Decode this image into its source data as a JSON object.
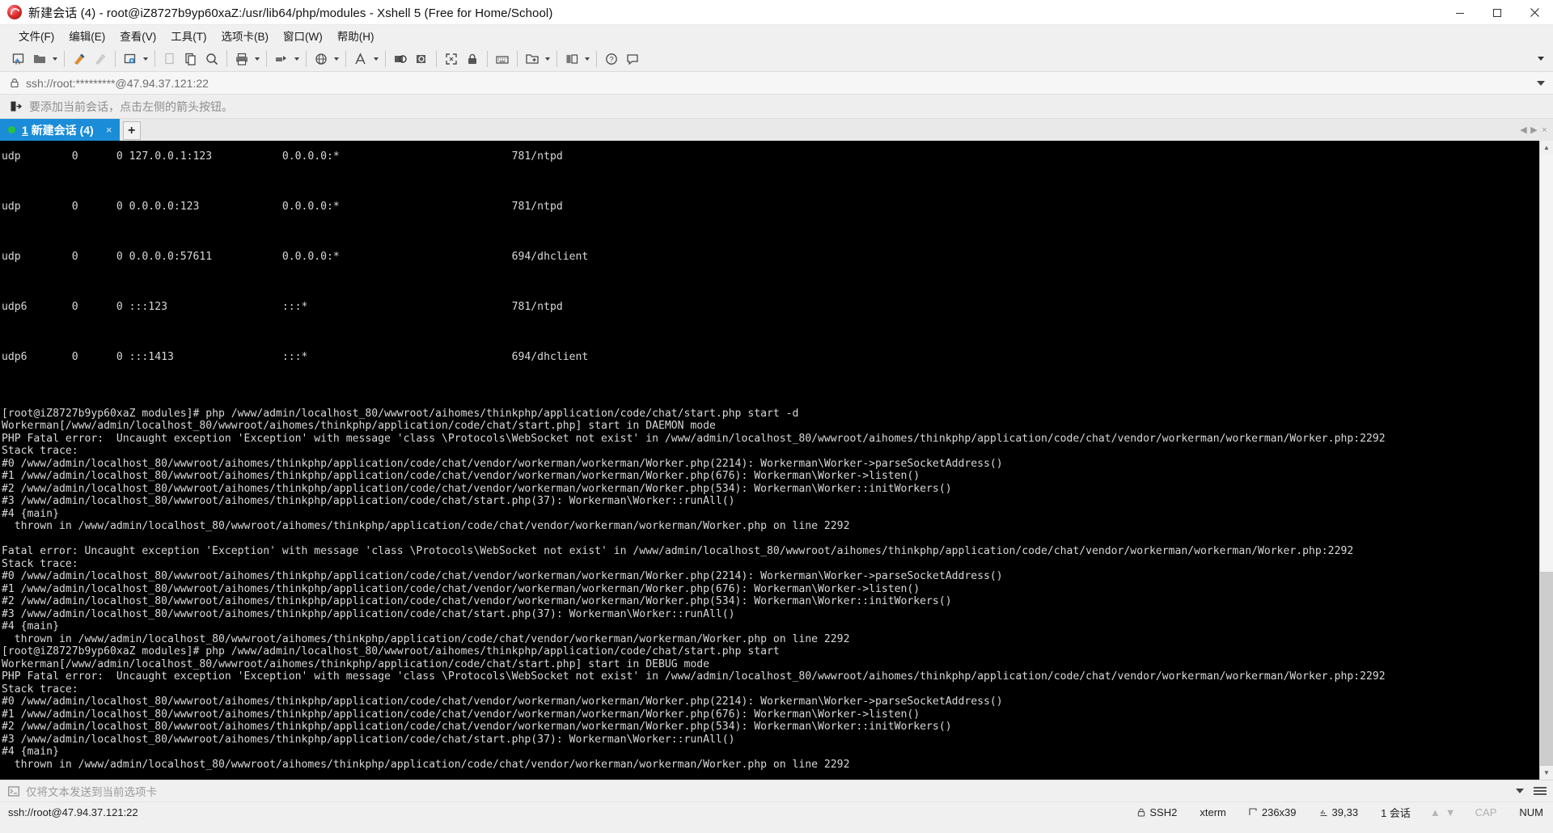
{
  "window": {
    "title": "新建会话 (4) - root@iZ8727b9yp60xaZ:/usr/lib64/php/modules - Xshell 5 (Free for Home/School)",
    "app_icon": "xshell-logo-icon",
    "minimize_label": "最小化",
    "maximize_label": "最大化",
    "close_label": "关闭"
  },
  "menubar": {
    "items": [
      {
        "label": "文件(F)",
        "name": "menu-file"
      },
      {
        "label": "编辑(E)",
        "name": "menu-edit"
      },
      {
        "label": "查看(V)",
        "name": "menu-view"
      },
      {
        "label": "工具(T)",
        "name": "menu-tools"
      },
      {
        "label": "选项卡(B)",
        "name": "menu-tab"
      },
      {
        "label": "窗口(W)",
        "name": "menu-window"
      },
      {
        "label": "帮助(H)",
        "name": "menu-help"
      }
    ]
  },
  "toolbar": {
    "buttons": [
      {
        "name": "new-session-icon",
        "title": "新建"
      },
      {
        "name": "open-folder-icon",
        "title": "打开"
      },
      {
        "name": "connect-icon",
        "title": "连接"
      },
      {
        "name": "disconnect-icon",
        "title": "断开"
      },
      {
        "name": "session-properties-icon",
        "title": "属性"
      },
      {
        "name": "copy-icon",
        "title": "复制"
      },
      {
        "name": "paste-icon",
        "title": "粘贴"
      },
      {
        "name": "find-icon",
        "title": "查找"
      },
      {
        "name": "print-icon",
        "title": "打印"
      },
      {
        "name": "transfer-icon",
        "title": "传输"
      },
      {
        "name": "globe-icon",
        "title": "编码"
      },
      {
        "name": "font-icon",
        "title": "字体"
      },
      {
        "name": "compose-icon",
        "title": "撰写栏"
      },
      {
        "name": "history-icon",
        "title": "历史"
      },
      {
        "name": "fullscreen-icon",
        "title": "全屏"
      },
      {
        "name": "lock-icon",
        "title": "锁定"
      },
      {
        "name": "keyboard-icon",
        "title": "键盘"
      },
      {
        "name": "add-folder-icon",
        "title": "添加文件夹"
      },
      {
        "name": "layout-icon",
        "title": "布局"
      },
      {
        "name": "help-icon",
        "title": "帮助"
      },
      {
        "name": "feedback-icon",
        "title": "反馈"
      }
    ],
    "overflow_label": "更多"
  },
  "address_bar": {
    "icon": "lock-icon",
    "value": "ssh://root:*********@47.94.37.121:22",
    "placeholder": "ssh://",
    "dropdown": "chevron-down-icon"
  },
  "hint_bar": {
    "icon": "add-session-arrow-icon",
    "text": "要添加当前会话，点击左侧的箭头按钮。"
  },
  "tabs": {
    "items": [
      {
        "status_dot": "connected-dot",
        "index": "1",
        "label": " 新建会话 (4)",
        "close": "×",
        "active": true
      }
    ],
    "new_tab_label": "+",
    "scroll_left": "◀",
    "scroll_right": "▶",
    "close_all": "×"
  },
  "terminal": {
    "prompt_host": "[root@iZ8727b9yp60xaZ modules]#",
    "columns": "236",
    "rows": "39",
    "lines": [
      "udp        0      0 127.0.0.1:123           0.0.0.0:*                           781/ntpd",
      "",
      "udp        0      0 0.0.0.0:123             0.0.0.0:*                           781/ntpd",
      "",
      "udp        0      0 0.0.0.0:57611           0.0.0.0:*                           694/dhclient",
      "",
      "udp6       0      0 :::123                  :::*                                781/ntpd",
      "",
      "udp6       0      0 :::1413                 :::*                                694/dhclient",
      "",
      "",
      "[root@iZ8727b9yp60xaZ modules]# php /www/admin/localhost_80/wwwroot/aihomes/thinkphp/application/code/chat/start.php start -d",
      "Workerman[/www/admin/localhost_80/wwwroot/aihomes/thinkphp/application/code/chat/start.php] start in DAEMON mode",
      "PHP Fatal error:  Uncaught exception 'Exception' with message 'class \\Protocols\\WebSocket not exist' in /www/admin/localhost_80/wwwroot/aihomes/thinkphp/application/code/chat/vendor/workerman/workerman/Worker.php:2292",
      "Stack trace:",
      "#0 /www/admin/localhost_80/wwwroot/aihomes/thinkphp/application/code/chat/vendor/workerman/workerman/Worker.php(2214): Workerman\\Worker->parseSocketAddress()",
      "#1 /www/admin/localhost_80/wwwroot/aihomes/thinkphp/application/code/chat/vendor/workerman/workerman/Worker.php(676): Workerman\\Worker->listen()",
      "#2 /www/admin/localhost_80/wwwroot/aihomes/thinkphp/application/code/chat/vendor/workerman/workerman/Worker.php(534): Workerman\\Worker::initWorkers()",
      "#3 /www/admin/localhost_80/wwwroot/aihomes/thinkphp/application/code/chat/start.php(37): Workerman\\Worker::runAll()",
      "#4 {main}",
      "  thrown in /www/admin/localhost_80/wwwroot/aihomes/thinkphp/application/code/chat/vendor/workerman/workerman/Worker.php on line 2292",
      "",
      "Fatal error: Uncaught exception 'Exception' with message 'class \\Protocols\\WebSocket not exist' in /www/admin/localhost_80/wwwroot/aihomes/thinkphp/application/code/chat/vendor/workerman/workerman/Worker.php:2292",
      "Stack trace:",
      "#0 /www/admin/localhost_80/wwwroot/aihomes/thinkphp/application/code/chat/vendor/workerman/workerman/Worker.php(2214): Workerman\\Worker->parseSocketAddress()",
      "#1 /www/admin/localhost_80/wwwroot/aihomes/thinkphp/application/code/chat/vendor/workerman/workerman/Worker.php(676): Workerman\\Worker->listen()",
      "#2 /www/admin/localhost_80/wwwroot/aihomes/thinkphp/application/code/chat/vendor/workerman/workerman/Worker.php(534): Workerman\\Worker::initWorkers()",
      "#3 /www/admin/localhost_80/wwwroot/aihomes/thinkphp/application/code/chat/start.php(37): Workerman\\Worker::runAll()",
      "#4 {main}",
      "  thrown in /www/admin/localhost_80/wwwroot/aihomes/thinkphp/application/code/chat/vendor/workerman/workerman/Worker.php on line 2292",
      "[root@iZ8727b9yp60xaZ modules]# php /www/admin/localhost_80/wwwroot/aihomes/thinkphp/application/code/chat/start.php start",
      "Workerman[/www/admin/localhost_80/wwwroot/aihomes/thinkphp/application/code/chat/start.php] start in DEBUG mode",
      "PHP Fatal error:  Uncaught exception 'Exception' with message 'class \\Protocols\\WebSocket not exist' in /www/admin/localhost_80/wwwroot/aihomes/thinkphp/application/code/chat/vendor/workerman/workerman/Worker.php:2292",
      "Stack trace:",
      "#0 /www/admin/localhost_80/wwwroot/aihomes/thinkphp/application/code/chat/vendor/workerman/workerman/Worker.php(2214): Workerman\\Worker->parseSocketAddress()",
      "#1 /www/admin/localhost_80/wwwroot/aihomes/thinkphp/application/code/chat/vendor/workerman/workerman/Worker.php(676): Workerman\\Worker->listen()",
      "#2 /www/admin/localhost_80/wwwroot/aihomes/thinkphp/application/code/chat/vendor/workerman/workerman/Worker.php(534): Workerman\\Worker::initWorkers()",
      "#3 /www/admin/localhost_80/wwwroot/aihomes/thinkphp/application/code/chat/start.php(37): Workerman\\Worker::runAll()",
      "#4 {main}",
      "  thrown in /www/admin/localhost_80/wwwroot/aihomes/thinkphp/application/code/chat/vendor/workerman/workerman/Worker.php on line 2292"
    ]
  },
  "send_bar": {
    "icon": "terminal-send-icon",
    "text": "仅将文本发送到当前选项卡",
    "dropdown": "chevron-down-icon",
    "menu": "hamburger-icon"
  },
  "status_bar": {
    "connection": "ssh://root@47.94.37.121:22",
    "protocol": "SSH2",
    "protocol_icon": "lock-icon",
    "terminal_type": "xterm",
    "size_icon": "resize-icon",
    "size": "236x39",
    "cursor_icon": "cursor-icon",
    "cursor": "39,33",
    "sessions": "1 会话",
    "up_arrow": "▲",
    "down_arrow": "▼",
    "cap": "CAP",
    "num": "NUM"
  },
  "colors": {
    "tab_active": "#1a8cd8",
    "terminal_bg": "#000000",
    "terminal_fg": "#d8d8d8",
    "chrome_bg": "#f0f0f0",
    "status_dot": "#27c23c"
  }
}
